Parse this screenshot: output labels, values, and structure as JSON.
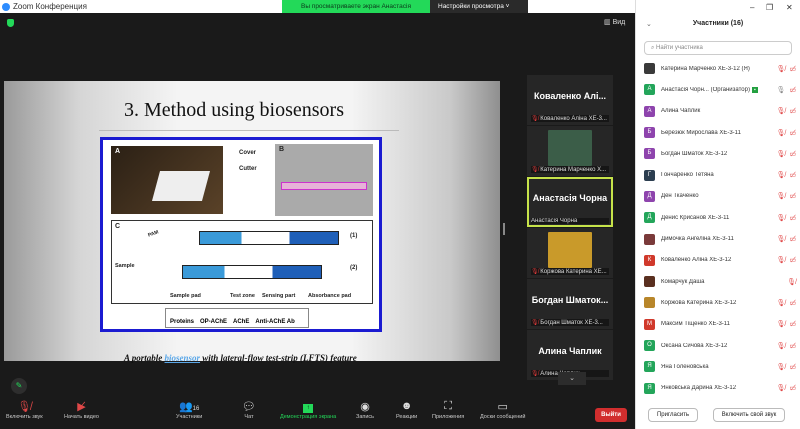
{
  "window": {
    "title": "Zoom Конференция"
  },
  "banner": {
    "viewing": "Вы просматриваете экран Анастасія Чорна",
    "settings": "Настройки просмотра",
    "settings_chevron": "˅"
  },
  "view_label": "Вид",
  "slide": {
    "title": "3. Method using biosensors",
    "figure": {
      "A": "A",
      "B": "B",
      "C": "C",
      "cover": "Cover",
      "cutter": "Cutter",
      "pam": "PAM",
      "sample": "Sample",
      "one": "(1)",
      "two": "(2)",
      "sample_pad": "Sample pad",
      "test_zone": "Test zone",
      "sensing_part": "Sensing part",
      "absorbance_pad": "Absorbance pad",
      "legend": [
        "Proteins",
        "OP-AChE",
        "AChE",
        "Anti-AChE Ab"
      ]
    },
    "caption_pre": "A portable ",
    "caption_link": "biosensor",
    "caption_post": " with lateral-flow test-strip (LFTS) feature"
  },
  "gallery": [
    {
      "big": "Коваленко  Алі...",
      "small": "Коваленко Аліна ХЕ-3...",
      "muted": true,
      "photo": false
    },
    {
      "big": "",
      "small": "Катерина Марченко Х...",
      "muted": true,
      "photo": true,
      "color": "#3b5d48"
    },
    {
      "big": "Анастасія Чорна",
      "small": "Анастасія Чорна",
      "muted": false,
      "photo": false,
      "active": true
    },
    {
      "big": "",
      "small": "Коржова Катерина ХЕ...",
      "muted": true,
      "photo": true,
      "color": "#c99a2a"
    },
    {
      "big": "Богдан  Шматок...",
      "small": "Богдан Шматок ХЕ-3...",
      "muted": true,
      "photo": false
    },
    {
      "big": "Алина Чаплик",
      "small": "Алина Чаплик",
      "muted": true,
      "photo": false
    }
  ],
  "toolbar": {
    "unmute": "Включить звук",
    "video": "Начать видео",
    "participants": "Участники",
    "participants_count": "16",
    "chat": "Чат",
    "share": "Демонстрация экрана",
    "record": "Запись",
    "reactions": "Реакции",
    "apps": "Приложения",
    "whiteboard": "Доски сообщений",
    "leave": "Выйти"
  },
  "panel": {
    "title": "Участники (16)",
    "search_placeholder": "Найти участника",
    "participants": [
      {
        "name": "Катерина Марченко ХЕ-3-12 (Я)",
        "initial": "",
        "color": "#3a3a3a",
        "video_off": true,
        "muted": true
      },
      {
        "name": "Анастасія Чорн... (Организатор)",
        "initial": "А",
        "color": "#23a55a",
        "badge": "▪",
        "muted": false,
        "video_off": true
      },
      {
        "name": "Алина Чаплик",
        "initial": "А",
        "color": "#8e44ad",
        "muted": true,
        "video_off": true
      },
      {
        "name": "Березюк Мирослава ХЕ-3-11",
        "initial": "Б",
        "color": "#8e44ad",
        "muted": true,
        "video_off": true
      },
      {
        "name": "Богдан Шматок ХЕ-3-12",
        "initial": "Б",
        "color": "#8e44ad",
        "muted": true,
        "video_off": true
      },
      {
        "name": "Гончаренко Тетяна",
        "initial": "Г",
        "color": "#2c3e50",
        "muted": true,
        "video_off": true
      },
      {
        "name": "Ден Ткаченко",
        "initial": "Д",
        "color": "#8e44ad",
        "muted": true,
        "video_off": true
      },
      {
        "name": "Денис Крисанов ХЕ-3-11",
        "initial": "Д",
        "color": "#23a55a",
        "muted": true,
        "video_off": true
      },
      {
        "name": "Димочка Ангеліна ХЕ-3-11",
        "initial": "",
        "color": "#7a3a3a",
        "muted": true,
        "video_off": true
      },
      {
        "name": "Коваленко Аліна ХЕ-3-12",
        "initial": "К",
        "color": "#d0392b",
        "muted": true,
        "video_off": true
      },
      {
        "name": "Комарчук Даша",
        "initial": "",
        "color": "#5a3020",
        "muted": true,
        "video_off": false
      },
      {
        "name": "Коржова Катерина ХЕ-3-12",
        "initial": "",
        "color": "#b8862a",
        "muted": true,
        "video_off": true
      },
      {
        "name": "Максим Тіщенко ХЕ-3-11",
        "initial": "М",
        "color": "#d0392b",
        "muted": true,
        "video_off": true
      },
      {
        "name": "Оксана Сичова ХЕ-3-12",
        "initial": "О",
        "color": "#23a55a",
        "muted": true,
        "video_off": true
      },
      {
        "name": "Яна Голеновська",
        "initial": "Я",
        "color": "#23a55a",
        "muted": true,
        "video_off": true
      },
      {
        "name": "Янковська Дарина ХЕ-3-12",
        "initial": "Я",
        "color": "#23a55a",
        "muted": true,
        "video_off": true
      }
    ],
    "invite": "Пригласить",
    "unmute_me": "Включить свой звук"
  }
}
